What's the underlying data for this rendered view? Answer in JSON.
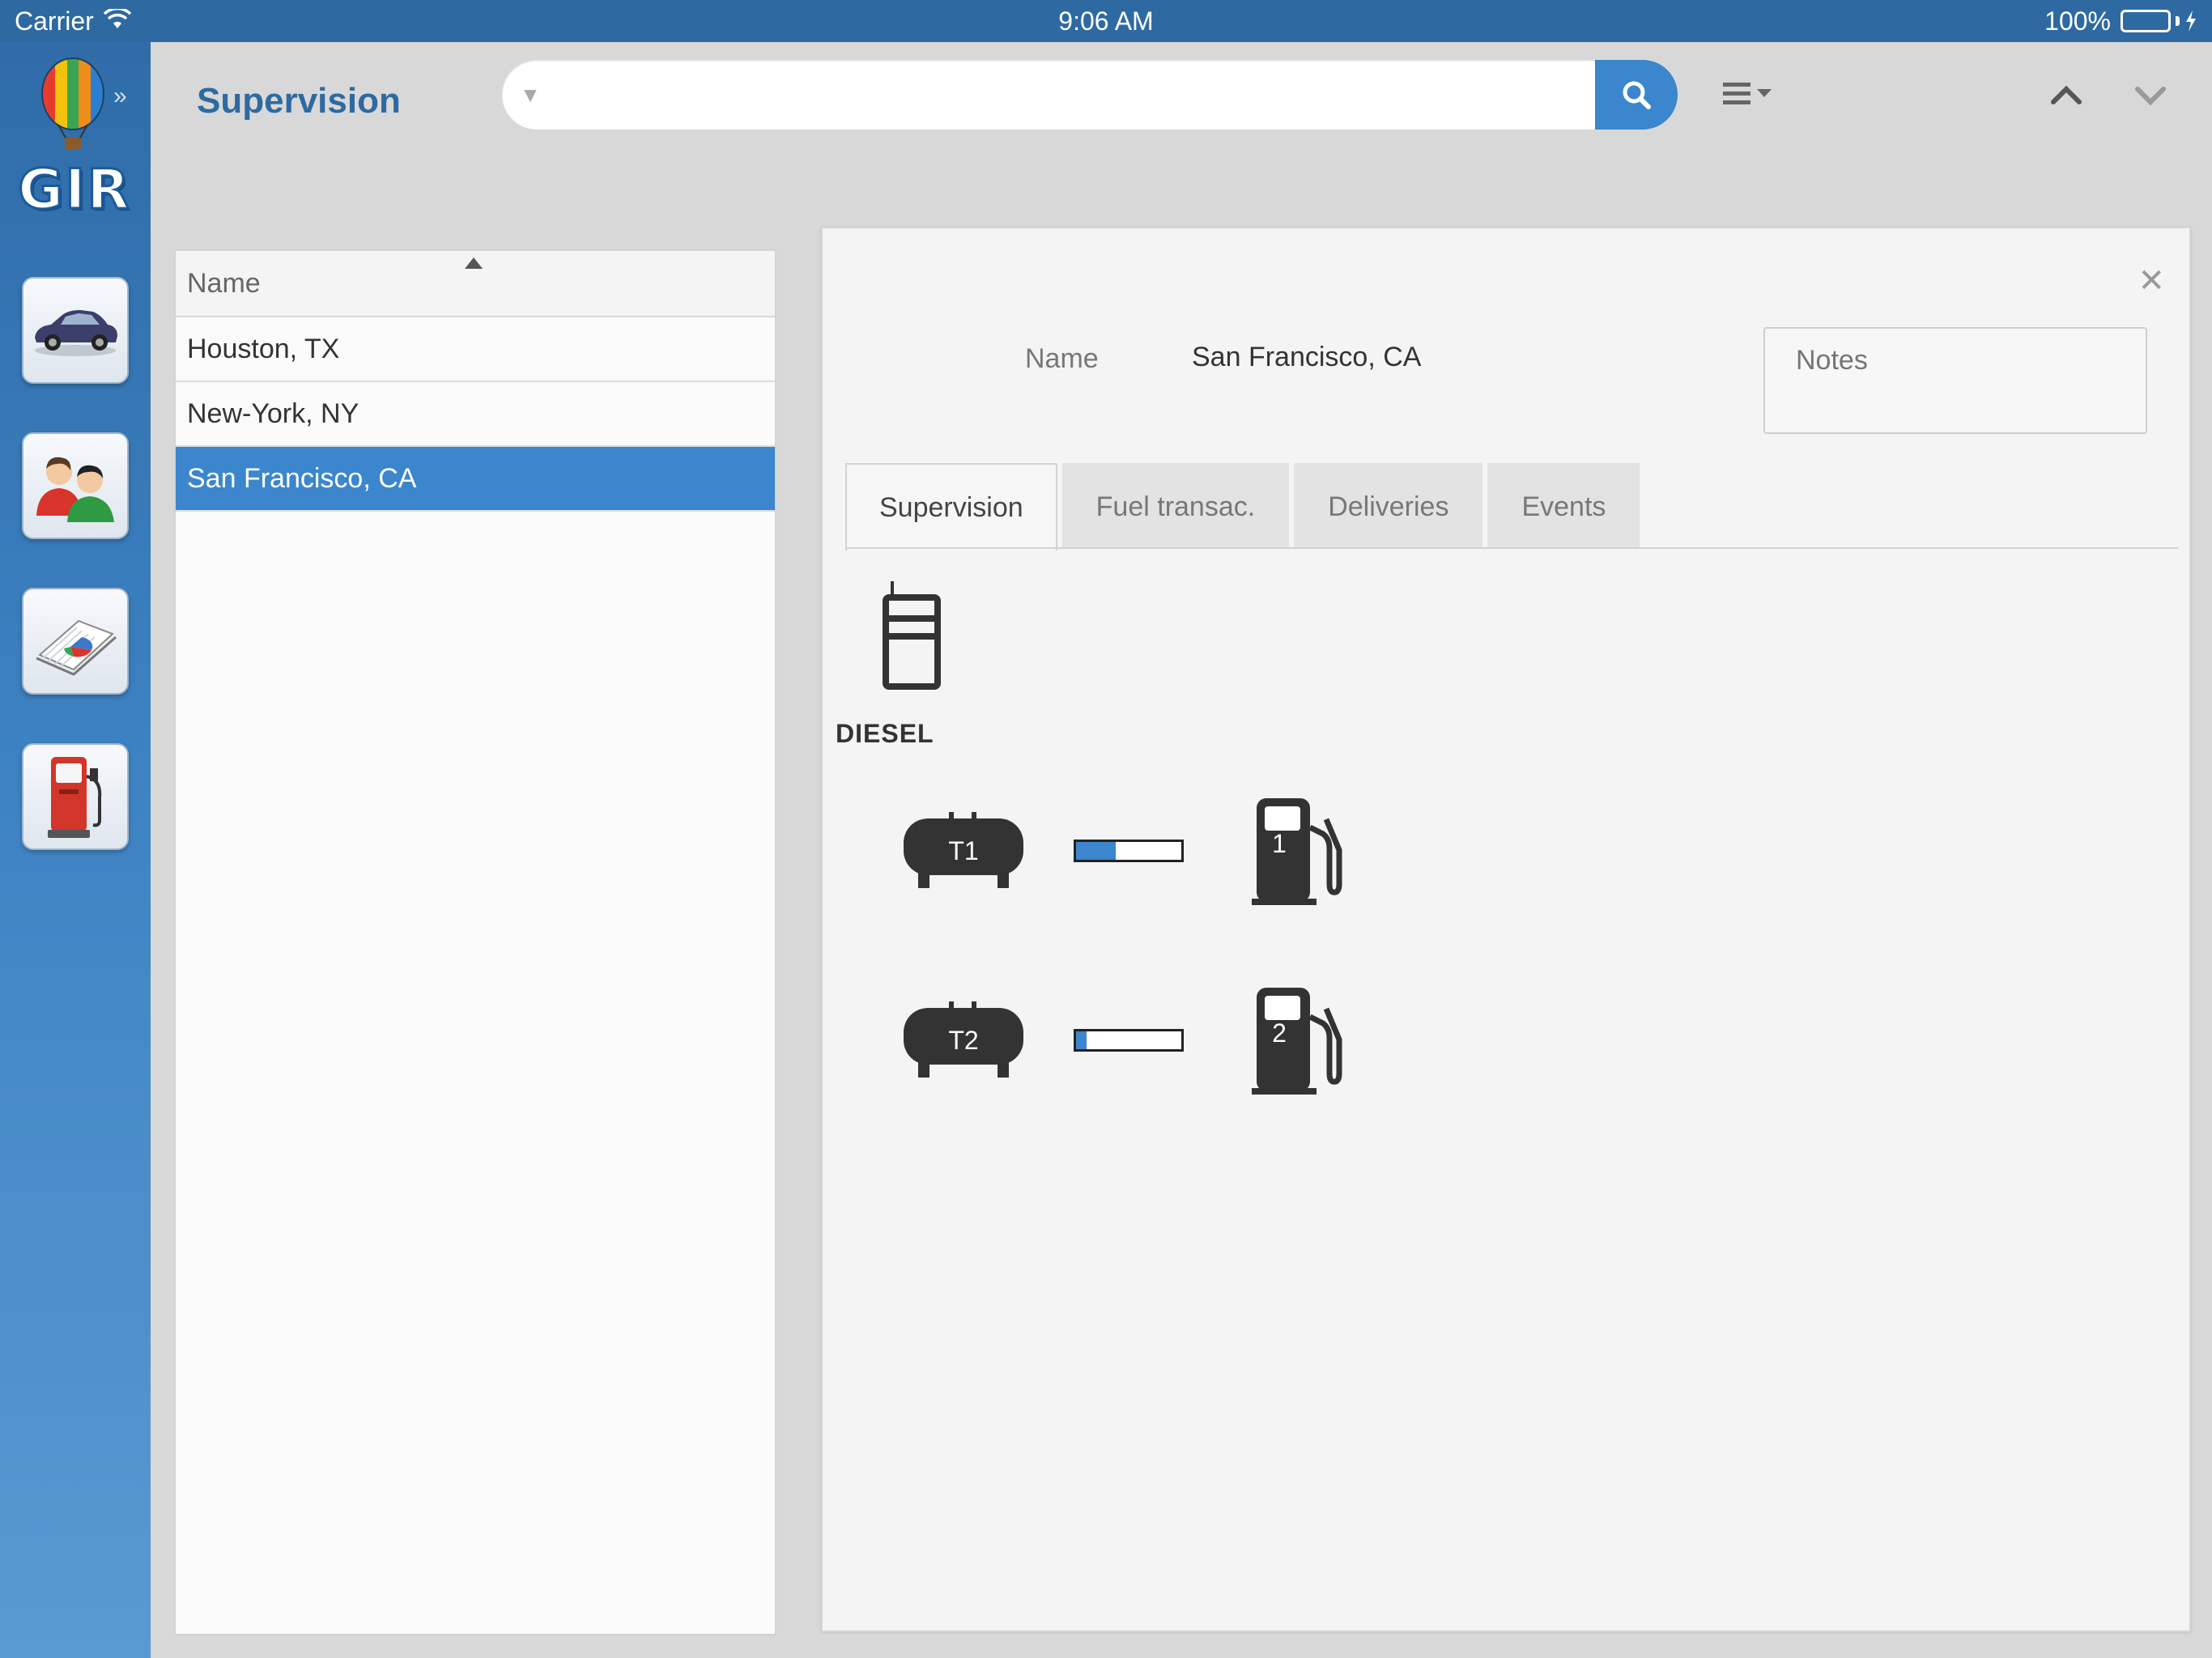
{
  "status_bar": {
    "carrier": "Carrier",
    "time": "9:06 AM",
    "battery": "100%"
  },
  "sidebar": {
    "logo_text": "GIR",
    "items": [
      {
        "name": "vehicles",
        "icon": "car-icon"
      },
      {
        "name": "users",
        "icon": "users-icon"
      },
      {
        "name": "reports",
        "icon": "report-chart-icon"
      },
      {
        "name": "fuel",
        "icon": "fuel-pump-icon"
      }
    ]
  },
  "header": {
    "title": "Supervision",
    "search": {
      "value": "",
      "placeholder": ""
    }
  },
  "list": {
    "column_header": "Name",
    "sort": "ascending",
    "rows": [
      "Houston, TX",
      "New-York, NY",
      "San Francisco, CA"
    ],
    "selected_index": 2
  },
  "detail": {
    "name_label": "Name",
    "name_value": "San Francisco, CA",
    "notes_placeholder": "Notes",
    "tabs": [
      "Supervision",
      "Fuel transac.",
      "Deliveries",
      "Events"
    ],
    "active_tab": 0,
    "fuel_type": "DIESEL",
    "tanks": [
      {
        "label": "T1",
        "level": 0.38,
        "pump": "1"
      },
      {
        "label": "T2",
        "level": 0.1,
        "pump": "2"
      }
    ]
  },
  "colors": {
    "accent": "#3b86cc",
    "status_bar": "#2e6aa1",
    "title": "#2e6aa1"
  }
}
